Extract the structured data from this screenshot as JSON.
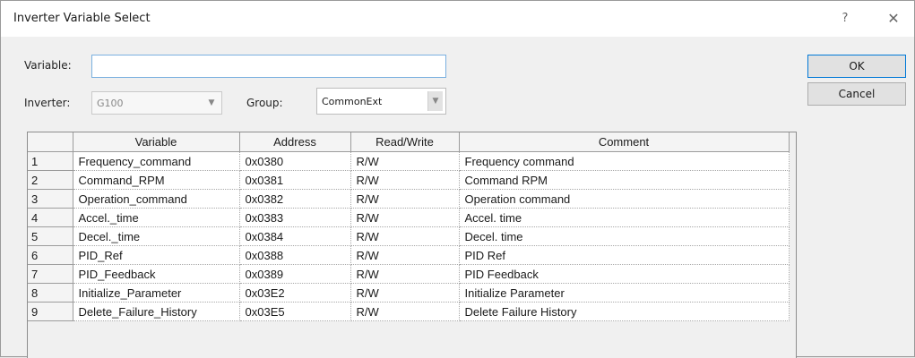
{
  "window": {
    "title": "Inverter Variable Select",
    "help_glyph": "?",
    "close_glyph": "✕"
  },
  "form": {
    "variable_label": "Variable:",
    "variable_value": "",
    "inverter_label": "Inverter:",
    "inverter_value": "G100",
    "group_label": "Group:",
    "group_value": "CommonExt"
  },
  "buttons": {
    "ok": "OK",
    "cancel": "Cancel"
  },
  "table": {
    "columns": [
      "",
      "Variable",
      "Address",
      "Read/Write",
      "Comment"
    ],
    "rows": [
      {
        "num": "1",
        "variable": "Frequency_command",
        "address": "0x0380",
        "rw": "R/W",
        "comment": "Frequency command"
      },
      {
        "num": "2",
        "variable": "Command_RPM",
        "address": "0x0381",
        "rw": "R/W",
        "comment": "Command RPM"
      },
      {
        "num": "3",
        "variable": "Operation_command",
        "address": "0x0382",
        "rw": "R/W",
        "comment": "Operation command"
      },
      {
        "num": "4",
        "variable": "Accel._time",
        "address": "0x0383",
        "rw": "R/W",
        "comment": "Accel. time"
      },
      {
        "num": "5",
        "variable": "Decel._time",
        "address": "0x0384",
        "rw": "R/W",
        "comment": "Decel. time"
      },
      {
        "num": "6",
        "variable": "PID_Ref",
        "address": "0x0388",
        "rw": "R/W",
        "comment": "PID Ref"
      },
      {
        "num": "7",
        "variable": "PID_Feedback",
        "address": "0x0389",
        "rw": "R/W",
        "comment": "PID Feedback"
      },
      {
        "num": "8",
        "variable": "Initialize_Parameter",
        "address": "0x03E2",
        "rw": "R/W",
        "comment": "Initialize Parameter"
      },
      {
        "num": "9",
        "variable": "Delete_Failure_History",
        "address": "0x03E5",
        "rw": "R/W",
        "comment": "Delete Failure History"
      }
    ]
  }
}
